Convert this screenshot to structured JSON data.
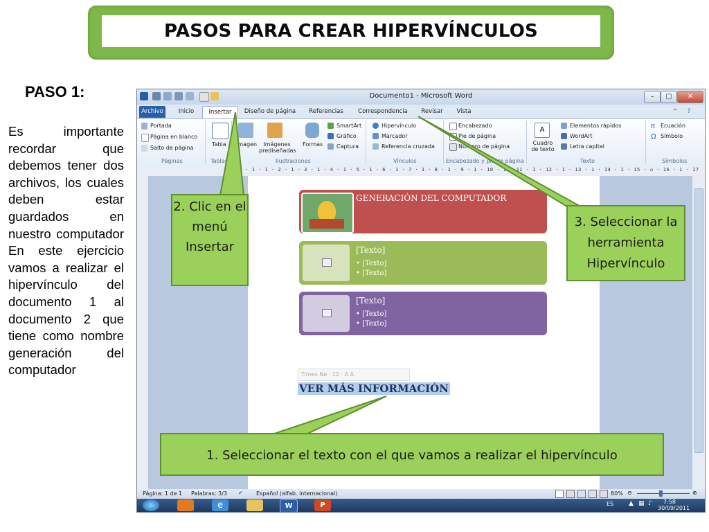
{
  "slide": {
    "title": "PASOS PARA CREAR HIPERVÍNCULOS",
    "step_heading": "PASO 1:",
    "instructions": "Es importante recordar que debemos tener dos archivos, los cuales deben estar guardados en nuestro computador En este ejercicio vamos a realizar el hipervínculo del documento 1 al documento 2 que tiene como nombre generación del computador"
  },
  "callouts": {
    "step1": "1. Seleccionar el texto con el que vamos a realizar el hipervínculo",
    "step2": "2. Clic en el menú Insertar",
    "step3": "3. Seleccionar la herramienta Hipervínculo"
  },
  "word": {
    "window_title": "Documento1 - Microsoft Word",
    "tabs": [
      "Archivo",
      "Inicio",
      "Insertar",
      "Diseño de página",
      "Referencias",
      "Correspondencia",
      "Revisar",
      "Vista"
    ],
    "active_tab": "Insertar",
    "ribbon": {
      "paginas": [
        "Portada",
        "Página en blanco",
        "Salto de página"
      ],
      "paginas_group": "Páginas",
      "tabla": "Tabla",
      "tablas_group": "Tablas",
      "imagen": "Imagen",
      "imagenes_predisenadas": "Imágenes prediseñadas",
      "formas": "Formas",
      "smartart": "SmartArt",
      "grafico": "Gráfico",
      "captura": "Captura",
      "ilustraciones_group": "Ilustraciones",
      "hipervinculo": "Hipervínculo",
      "marcador": "Marcador",
      "referencia_cruzada": "Referencia cruzada",
      "vinculos_group": "Vínculos",
      "encabezado": "Encabezado",
      "pie_de_pagina": "Pie de página",
      "numero_de_pagina": "Número de página",
      "encabezado_group": "Encabezado y pie de página",
      "cuadro_de_texto": "Cuadro de texto",
      "elementos_rapidos": "Elementos rápidos",
      "wordart": "WordArt",
      "letra_capital": "Letra capital",
      "texto_group": "Texto",
      "ecuacion": "Ecuación",
      "simbolo": "Símbolo",
      "simbolos_group": "Símbolos"
    },
    "ruler": "1 · 2 · 1 · 1 · 2 · 1 · 3 · 1 · 4 · 1 · 5 · 1 · 6 · 1 · 7 · 1 · 8 · 1 · 9 · 1 · 10 · 1 · 11 · 1 · 12 · 1 · 13 · 1 · 14 · 1 · 15 · ⌂ · 16 · 1 · 17",
    "smartart": {
      "box1_title": "GENERACIÓN DEL COMPUTADOR",
      "box2_title": "[Texto]",
      "box2_bullets": [
        "• [Texto]",
        "• [Texto]"
      ],
      "box3_title": "[Texto]",
      "box3_bullets": [
        "• [Texto]",
        "• [Texto]"
      ],
      "colors": {
        "box1": "#c0504d",
        "box2": "#9bbb59",
        "box3": "#8064a2"
      }
    },
    "minitoolbar": "Times Ne · 12 · A A",
    "selected_text": "VER MÁS INFORMACIÓN",
    "status": {
      "page": "Página: 1 de 1",
      "words": "Palabras: 3/3",
      "language": "Español (alfab. internacional)",
      "zoom": "80%"
    },
    "taskbar": {
      "lang": "ES",
      "time": "7:58",
      "date": "30/09/2011"
    }
  }
}
